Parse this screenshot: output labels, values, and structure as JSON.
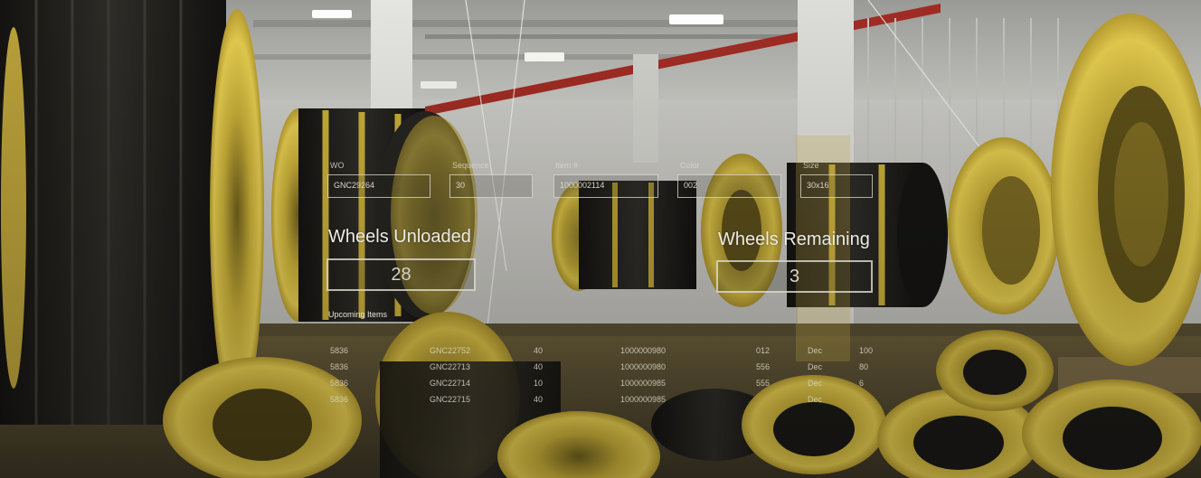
{
  "header_fields": [
    {
      "label": "WO",
      "value": "GNC29264"
    },
    {
      "label": "Sequence",
      "value": "30"
    },
    {
      "label": "Item #",
      "value": "1000002114"
    },
    {
      "label": "Color",
      "value": "002"
    },
    {
      "label": "Size",
      "value": "30x16"
    }
  ],
  "wheels_unloaded": {
    "label": "Wheels Unloaded",
    "value": "28"
  },
  "wheels_remaining": {
    "label": "Wheels Remaining",
    "value": "3"
  },
  "upcoming": {
    "label": "Upcoming Items",
    "rows": [
      [
        "5836",
        "GNC22752",
        "40",
        "1000000980",
        "012",
        "Dec",
        "100"
      ],
      [
        "5836",
        "GNC22713",
        "40",
        "1000000980",
        "556",
        "Dec",
        "80"
      ],
      [
        "5836",
        "GNC22714",
        "10",
        "1000000985",
        "555",
        "Dec",
        "6"
      ],
      [
        "5836",
        "GNC22715",
        "40",
        "1000000985",
        "",
        "Dec",
        ""
      ]
    ]
  },
  "colors": {
    "wheel_yellow": "#c9b03a",
    "tire_black": "#1e1d1a",
    "wall": "#d8d8d4",
    "pipe_red": "#a02c24"
  }
}
